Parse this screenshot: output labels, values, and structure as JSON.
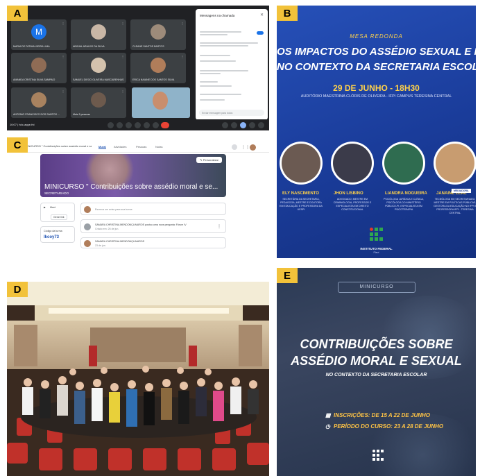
{
  "panels": {
    "a": {
      "label": "A"
    },
    "b": {
      "label": "B"
    },
    "c": {
      "label": "C"
    },
    "d": {
      "label": "D"
    },
    "e": {
      "label": "E"
    }
  },
  "meet": {
    "participants": [
      {
        "name": "MARIA DE FATIMA VIEIRA LIMA",
        "avatar_letter": "M",
        "avatar_color": "#1a73e8"
      },
      {
        "name": "ABIGAIL ARAÚJO DA SILVA",
        "avatar_letter": "",
        "avatar_color": "#c9b7a6"
      },
      {
        "name": "CLEANE SANTOS BASTOS",
        "avatar_letter": "",
        "avatar_color": "#9d8b7a"
      },
      {
        "name": "AMANDA CRISTINA SILVA SAMPAIO",
        "avatar_letter": "",
        "avatar_color": "#8f6c55"
      },
      {
        "name": "SAMUEL DIEGO OLIVEIRA MASCARENHAS",
        "avatar_letter": "",
        "avatar_color": "#d4c2ad"
      },
      {
        "name": "ERICA NAIANE DOS SANTOS SILVA",
        "avatar_letter": "",
        "avatar_color": "#b07d5a"
      },
      {
        "name": "ANTONIO FRANCISCO DOS SANTOS ...",
        "avatar_letter": "",
        "avatar_color": "#a8825f"
      },
      {
        "name": "Mais 5 pessoas",
        "avatar_letter": "",
        "avatar_color": "#6d5a4d"
      }
    ],
    "chat_title": "Mensagens na chamada",
    "chat_input_placeholder": "Enviar mensagem para todos",
    "time": "16:07",
    "meeting_code": "hdc-aqqe-fni"
  },
  "poster_b": {
    "subtitle": "MESA REDONDA",
    "title_line1": "OS IMPACTOS DO ASSÉDIO SEXUAL E MORAL",
    "title_line2": "NO CONTEXTO DA SECRETARIA ESCOLAR",
    "date": "29 DE JUNHO - 18H30",
    "place": "AUDITÓRIO MAESTRINA CLÓRIS DE OLIVEIRA - IFPI CAMPUS TERESINA CENTRAL",
    "speakers": [
      {
        "name": "ELY NASCIMENTO",
        "desc": "SECRETÁRIA DA SECRETARIA, PEDAGOGA, MESTRE E DOUTORA EM EDUCAÇÃO E PROFESSORA DA UESPI",
        "color": "#6b5a52"
      },
      {
        "name": "JHON LISBINO",
        "desc": "ADVOGADO, MESTRE EM CRIMINOLOGIA, PROFESSOR E ESPECIALISTA EM DIREITO CONSTITUCIONAL",
        "color": "#3b3b4a"
      },
      {
        "name": "LIANDRA NOGUEIRA",
        "desc": "PSICÓLOGA JURÍDICA E CLÍNICA, PSICÓLOGA DO MINISTÉRIO PÚBLICO-PI, ESPECIALISTA EM PSICOTERAPIA",
        "color": "#2f6c50"
      },
      {
        "name": "JANAINE LEAL",
        "desc": "TECNÓLOGA EM SECRETARIADO, MESTRE EM POLÍTICAS PÚBLICAS, GESTORA DA EDUCAÇÃO NO IFPI E PROFESSORA IFPI - TERESINA CENTRAL",
        "color": "#c89c70"
      }
    ],
    "mediator_badge": "MEDIADORA",
    "institution": "INSTITUTO FEDERAL",
    "institution_sub": "Piauí"
  },
  "classroom": {
    "course_title": "MINICURSO \" Contribuições sobre assédio moral e sexual no contexto da Secretaria Escolar\"",
    "tabs": [
      "Mural",
      "Atividades",
      "Pessoas",
      "Notas"
    ],
    "banner_title": "MINICURSO \" Contribuições sobre assédio moral e se...",
    "banner_subtitle": "SECRETARIADO",
    "customize": "Personalizar",
    "meet_label": "Meet",
    "meet_action": "Gerar link",
    "class_code_label": "Código da turma",
    "class_code": "lkcoy73",
    "post_placeholder": "Escreva um aviso para sua turma",
    "posts": [
      {
        "author": "SAMARA CHRISTINA MENDONÇA MAROS postou uma nova pergunta: Fórum IV",
        "date": "Criado em: 26 de jun."
      },
      {
        "author": "SAMARA CHRISTINA MENDONÇA MAROS",
        "date": "23 de jun."
      }
    ]
  },
  "poster_e": {
    "badge": "MINICURSO",
    "title_line1": "CONTRIBUIÇÕES SOBRE",
    "title_line2": "ASSÉDIO MORAL E SEXUAL",
    "subtitle": "NO CONTEXTO DA SECRETARIA ESCOLAR",
    "registration": "INSCRIÇÕES: DE 15 A 22 DE JUNHO",
    "period": "PERÍODO DO CURSO: 23 A 28 DE JUNHO"
  }
}
